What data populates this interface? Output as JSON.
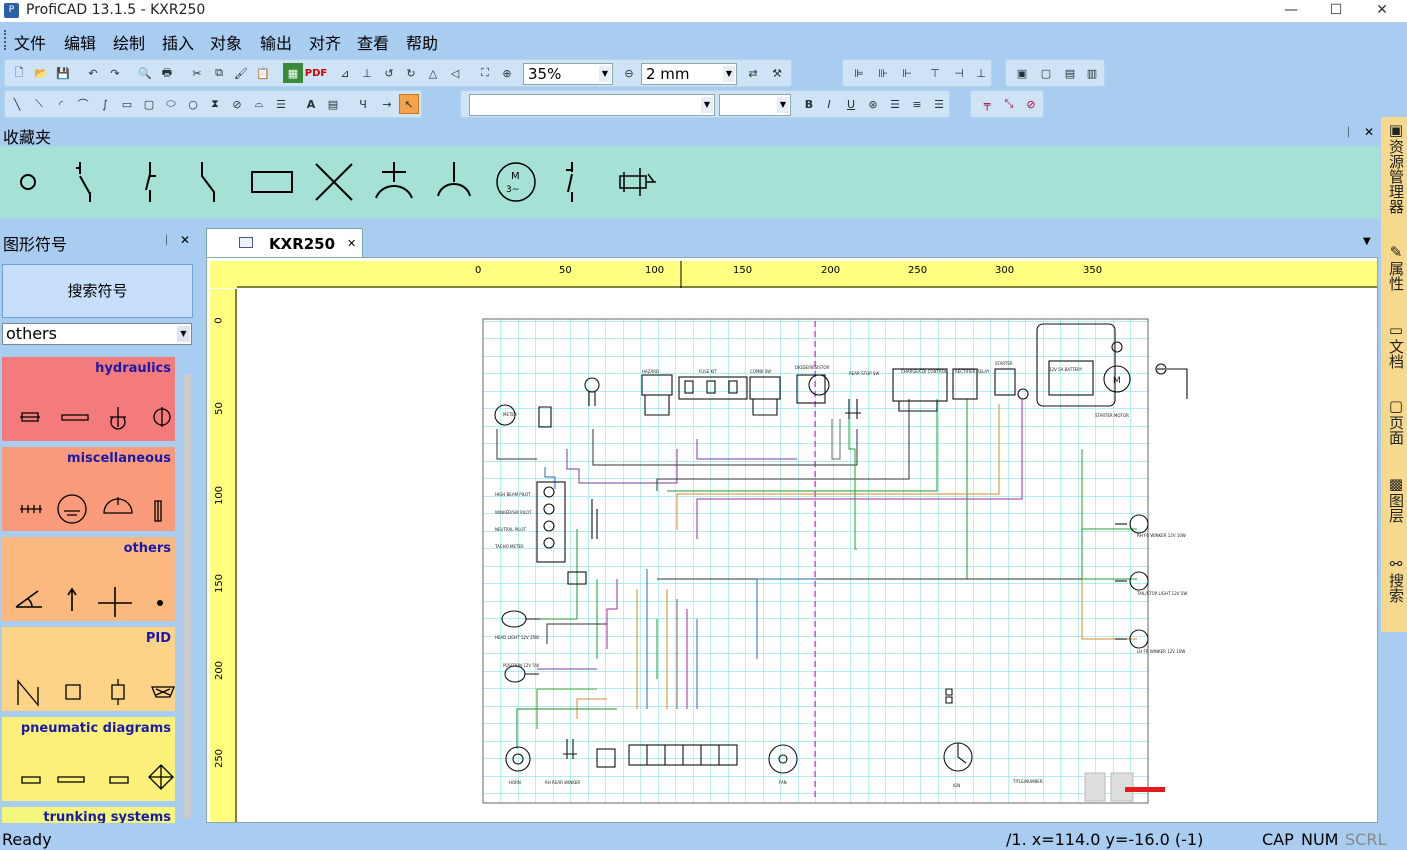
{
  "window": {
    "title": "ProfiCAD 13.1.5 - KXR250",
    "app_icon": "P",
    "buttons": [
      "—",
      "☐",
      "✕"
    ]
  },
  "menu": [
    "文件",
    "编辑",
    "绘制",
    "插入",
    "对象",
    "输出",
    "对齐",
    "查看",
    "帮助"
  ],
  "toolbar": {
    "zoom": "35%",
    "line_width": "2 mm",
    "font_name": "",
    "font_size": "",
    "bold": "B",
    "italic": "I",
    "underline": "U",
    "pdf": "PDF"
  },
  "favorites": {
    "title": "收藏夹",
    "pin": "ᛁ",
    "close": "✕"
  },
  "symbols_panel": {
    "title": "图形符号",
    "pin": "ᛁ",
    "close": "✕",
    "search_button": "搜索符号",
    "category_select": "others",
    "categories": [
      {
        "title": "hydraulics",
        "color": "#f47b7b"
      },
      {
        "title": "miscellaneous",
        "color": "#f99b7a"
      },
      {
        "title": "others",
        "color": "#fbb980"
      },
      {
        "title": "PID",
        "color": "#fcd387"
      },
      {
        "title": "pneumatic diagrams",
        "color": "#fbf07a"
      },
      {
        "title": "trunking systems",
        "color": "#f4f77b"
      }
    ]
  },
  "document": {
    "tab": "KXR250",
    "tab_close": "✕",
    "menu_arrow": "▼",
    "hruler_labels": [
      "0",
      "50",
      "100",
      "150",
      "200",
      "250",
      "300",
      "350"
    ],
    "vruler_labels": [
      "0",
      "50",
      "100",
      "150",
      "200",
      "250"
    ]
  },
  "schematic_labels": {
    "meter": "METER",
    "hazard": "HAZARD",
    "fuse": "FUSE KIT",
    "combi": "COMBI SW",
    "diode": "DIODE/RESISTOR",
    "rear": "REAR STOP SW",
    "chdi": "CHARGE/CDI CONTROL",
    "rectifier": "RECTIFIER RELAY",
    "starter": "STARTER",
    "battery": "12V 5A BATTERY",
    "starter_motor": "STARTER MOTOR",
    "motor": "M",
    "high_beam": "HIGH BEAM PILOT",
    "winker_pilot": "WINKER/SW PILOT",
    "neutral": "NEUTRAL PILOT",
    "tach": "TACHO METER",
    "headlight": "HEAD LIGHT  12V 35W",
    "position": "POSITION 12V 5W",
    "rh_winker": "RH FR WINKER  12V 10W",
    "tail": "TAIL/STOP LIGHT 12V 5W",
    "lh_winker": "LH FR WINKER  12V 10W",
    "horn": "HORN",
    "rh_rear": "RH REAR WINKER",
    "fan": "FAN",
    "ignition": "IGN",
    "title_block": "TITLE/NUMBER"
  },
  "side_tabs": [
    "资源管理器",
    "属性",
    "文档",
    "页面",
    "图层",
    "搜索"
  ],
  "status": {
    "ready": "Ready",
    "coords": "/1.  x=114.0  y=-16.0 (-1)",
    "cap": "CAP",
    "num": "NUM",
    "scrl": "SCRL"
  },
  "colors": {
    "background": "#a9cdf1",
    "favorites": "#a5e2d5",
    "ruler": "#ffff80",
    "grid": "#66dde0",
    "sidebar": "#f6d98c"
  }
}
